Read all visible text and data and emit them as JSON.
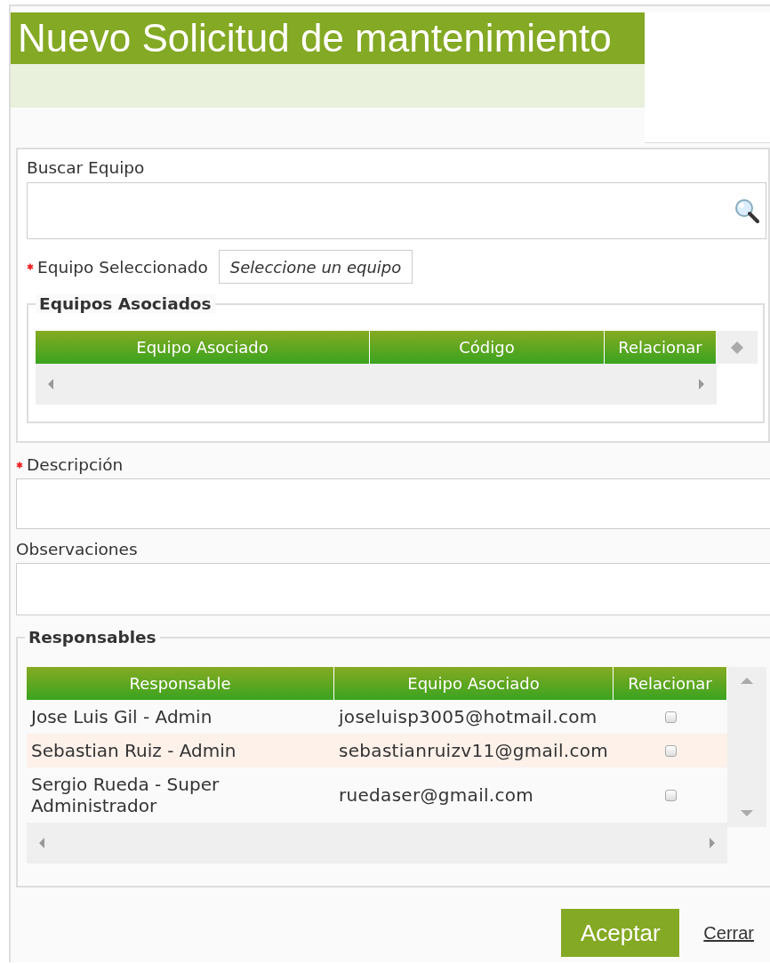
{
  "window": {
    "title": "Nuevo Solicitud de mantenimiento"
  },
  "search": {
    "label": "Buscar Equipo"
  },
  "selected_equipment": {
    "label": "Equipo Seleccionado",
    "required": true,
    "value": "Seleccione un equipo"
  },
  "associated_equipment": {
    "legend": "Equipos Asociados",
    "columns": [
      "Equipo Asociado",
      "Código",
      "Relacionar"
    ]
  },
  "description": {
    "label": "Descripción",
    "required": true
  },
  "observations": {
    "label": "Observaciones",
    "required": false
  },
  "responsibles": {
    "legend": "Responsables",
    "columns": [
      "Responsable",
      "Equipo Asociado",
      "Relacionar"
    ],
    "rows": [
      {
        "name": "Jose Luis Gil - Admin",
        "email": "joseluisp3005@hotmail.com",
        "checked": false,
        "highlighted": false
      },
      {
        "name": "Sebastian Ruiz - Admin",
        "email": "sebastianruizv11@gmail.com",
        "checked": false,
        "highlighted": true
      },
      {
        "name": "Sergio Rueda - Super Administrador",
        "email": "ruedaser@gmail.com",
        "checked": false,
        "highlighted": false
      }
    ]
  },
  "buttons": {
    "accept": "Aceptar",
    "close": "Cerrar"
  }
}
